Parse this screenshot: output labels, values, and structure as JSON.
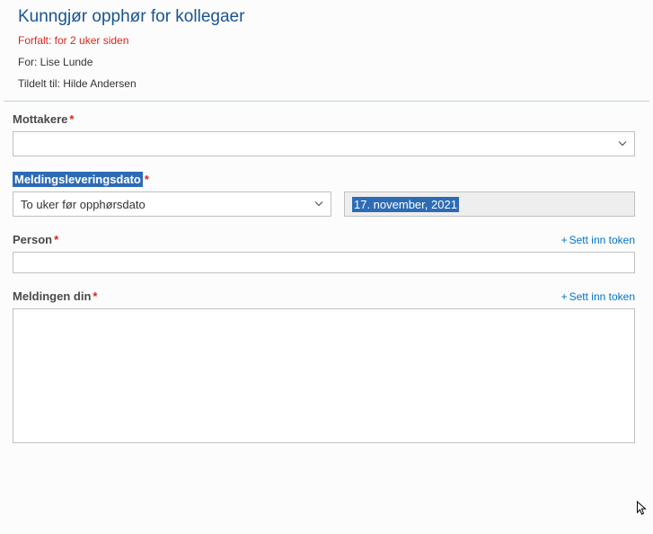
{
  "header": {
    "title": "Kunngjør opphør for kollegaer",
    "forfalt": "Forfalt: for 2 uker siden",
    "for_line": "For: Lise Lunde",
    "tildelt_line": "Tildelt til: Hilde Andersen"
  },
  "fields": {
    "mottakere": {
      "label": "Mottakere",
      "value": ""
    },
    "melddato": {
      "label": "Meldingsleveringsdato",
      "select_value": "To uker før opphørsdato",
      "date_value": "17. november, 2021"
    },
    "person": {
      "label": "Person",
      "token_link": "Sett inn token",
      "value": ""
    },
    "melding": {
      "label": "Meldingen din",
      "token_link": "Sett inn token",
      "value": ""
    }
  }
}
